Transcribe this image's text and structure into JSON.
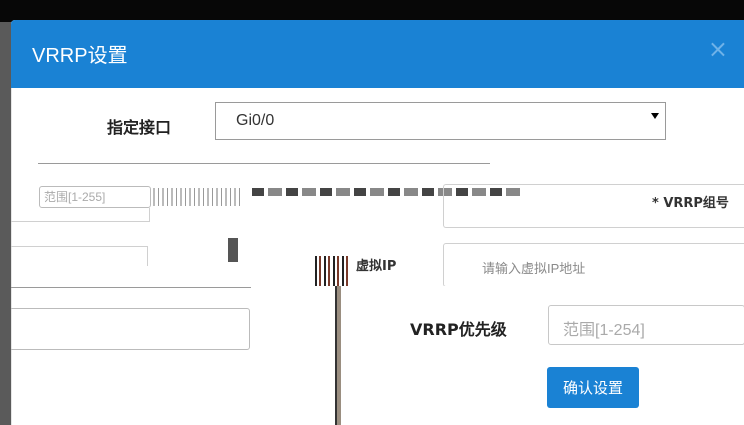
{
  "dialog": {
    "title": "VRRP设置",
    "close_symbol": "×"
  },
  "form": {
    "interface_label": "指定接口",
    "interface_value": "Gi0/0",
    "group_label": "* VRRP组号",
    "range_placeholder_1": "范围[1-255]",
    "virtual_ip_label": "虚拟IP",
    "virtual_ip_placeholder": "请输入虚拟IP地址",
    "priority_label": "VRRP优先级",
    "priority_placeholder": "范围[1-254]",
    "confirm_label": "确认设置"
  },
  "icons": {
    "close": "close-icon",
    "dropdown": "caret-down-icon"
  },
  "colors": {
    "accent": "#1a82d4",
    "header_text": "#ffffff",
    "overlay": "#5a5a5a"
  }
}
